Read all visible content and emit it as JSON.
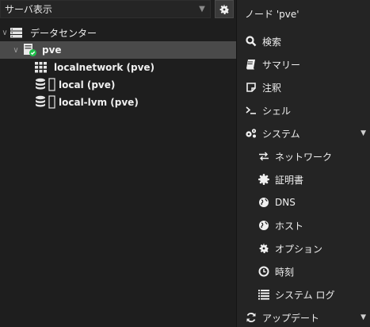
{
  "left": {
    "view_select": {
      "value": "サーバ表示"
    },
    "tree": {
      "datacenter": {
        "label": "データセンター"
      },
      "node": {
        "label": "pve"
      },
      "children": [
        {
          "label": "localnetwork (pve)",
          "icon": "grid-icon"
        },
        {
          "label": "local (pve)",
          "icon": "database-icon"
        },
        {
          "label": "local-lvm (pve)",
          "icon": "database-icon"
        }
      ]
    }
  },
  "right": {
    "title": "ノード 'pve'",
    "nav": {
      "search": "検索",
      "summary": "サマリー",
      "notes": "注釈",
      "shell": "シェル",
      "system": "システム",
      "network": "ネットワーク",
      "certificates": "証明書",
      "dns": "DNS",
      "hosts": "ホスト",
      "options": "オプション",
      "time": "時刻",
      "syslog": "システム ログ",
      "updates": "アップデート"
    }
  }
}
